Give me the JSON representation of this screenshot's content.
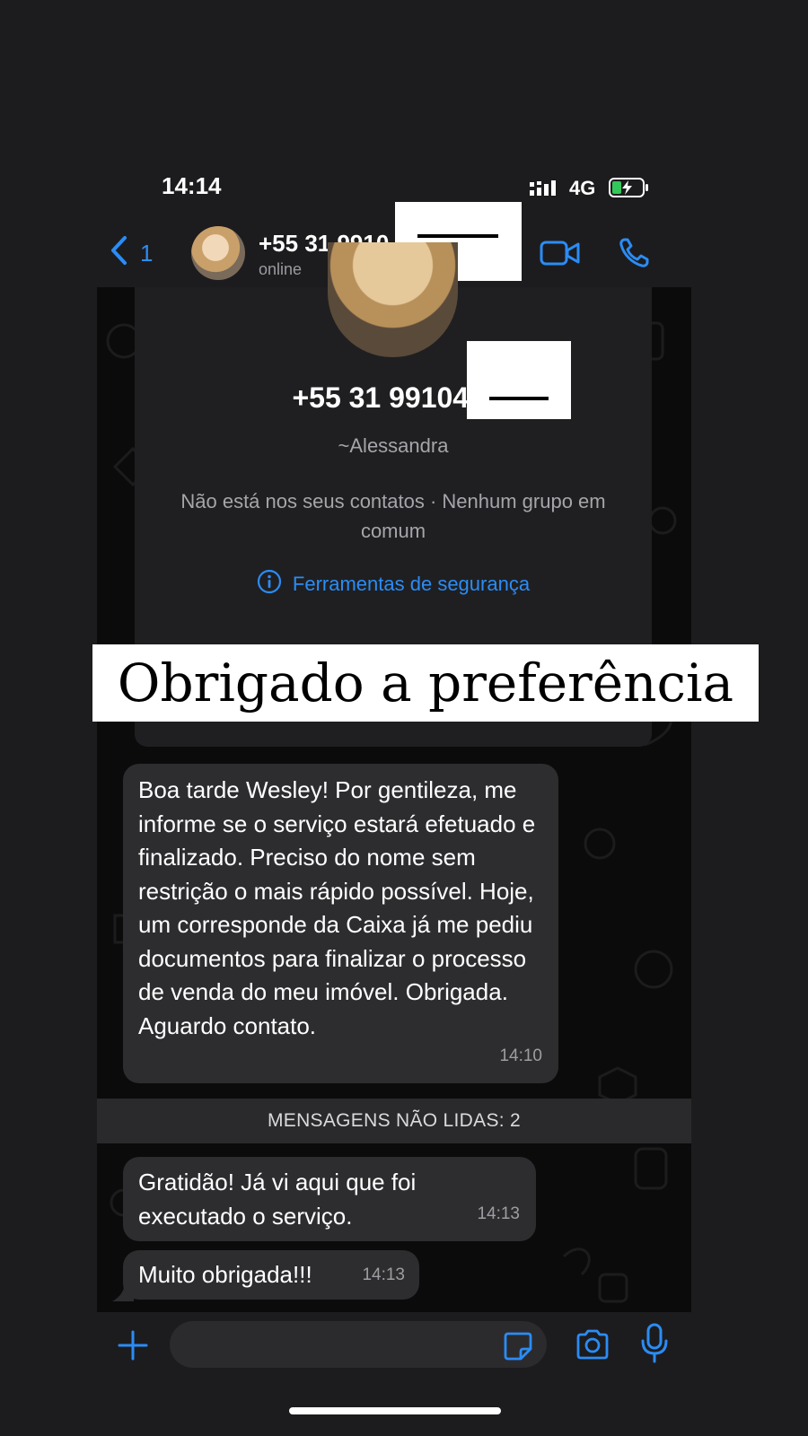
{
  "status_bar": {
    "time": "14:14",
    "network": "4G"
  },
  "header": {
    "back_count": "1",
    "contact_phone": "+55 31 9910",
    "contact_status": "online"
  },
  "contact_card": {
    "phone": "+55 31 99104-4",
    "name": "~Alessandra",
    "info": "Não está nos seus contatos · Nenhum grupo em comum",
    "security_link": "Ferramentas de segurança"
  },
  "caption": "Obrigado a preferência",
  "messages": [
    {
      "text": "Boa tarde Wesley! Por gentileza, me informe se o serviço estará efetuado e finalizado. Preciso do nome sem restrição o mais rápido possível. Hoje, um corresponde da Caixa já me pediu documentos para finalizar o processo de venda do meu imóvel. Obrigada. Aguardo contato.",
      "time": "14:10"
    },
    {
      "text": "Gratidão! Já vi aqui que foi executado o serviço.",
      "time": "14:13"
    },
    {
      "text": "Muito obrigada!!!",
      "time": "14:13"
    }
  ],
  "unread_divider": "MENSAGENS NÃO LIDAS: 2",
  "input": {
    "placeholder": ""
  },
  "colors": {
    "accent": "#2b8cf5",
    "bubble": "#2d2d30",
    "background": "#1c1c1e"
  }
}
